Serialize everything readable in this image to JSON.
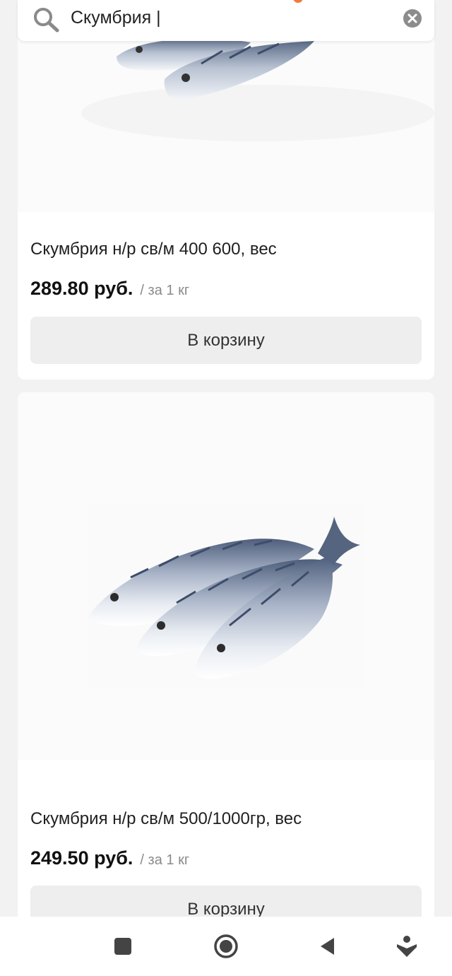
{
  "search": {
    "value": "Скумбрия |",
    "placeholder": ""
  },
  "products": [
    {
      "title": "Скумбрия н/р св/м 400 600, вес",
      "price": "289.80 руб.",
      "unit": "/ за 1 кг",
      "button_label": "В корзину",
      "image_icon": "mackerel-fish-image"
    },
    {
      "title": "Скумбрия н/р св/м 500/1000гр, вес",
      "price": "249.50 руб.",
      "unit": "/ за 1 кг",
      "button_label": "В корзину",
      "image_icon": "mackerel-fish-image"
    }
  ],
  "navbar": {
    "items": [
      "square-icon",
      "home-circle-icon",
      "back-triangle-icon",
      "assistant-icon"
    ]
  },
  "colors": {
    "background": "#f2f2f2",
    "card": "#ffffff",
    "button": "#eeeeee",
    "notification": "#f07a3a",
    "fish_stripe": "#3d4d6a"
  }
}
